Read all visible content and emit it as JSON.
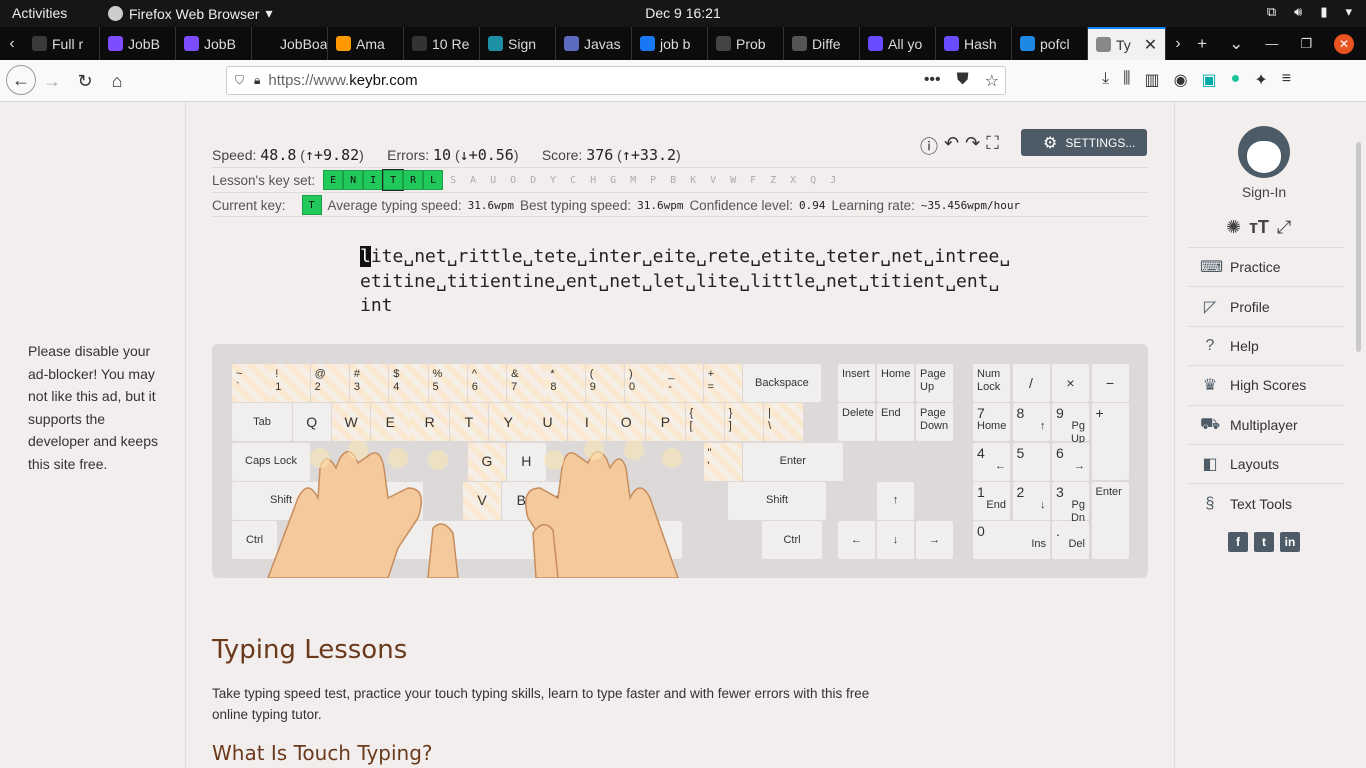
{
  "topbar": {
    "activities": "Activities",
    "app_name": "Firefox Web Browser",
    "app_menu_icon": "chevron-down-icon",
    "clock": "Dec 9  16:21"
  },
  "tabs": [
    {
      "title": "Full r",
      "icon_color": "#3a3a3a"
    },
    {
      "title": "JobB",
      "icon_color": "#7b4dff"
    },
    {
      "title": "JobB",
      "icon_color": "#7b4dff"
    },
    {
      "title": "JobBoar",
      "icon_color": ""
    },
    {
      "title": "Ama",
      "icon_color": "#ff9900"
    },
    {
      "title": "10 Re",
      "icon_color": "#333"
    },
    {
      "title": "Sign",
      "icon_color": "#1e90a6"
    },
    {
      "title": "Javas",
      "icon_color": "#5c6bc0"
    },
    {
      "title": "job b",
      "icon_color": "#1877f2"
    },
    {
      "title": "Prob",
      "icon_color": "#444"
    },
    {
      "title": "Diffe",
      "icon_color": "#555"
    },
    {
      "title": "All yo",
      "icon_color": "#6a4cff"
    },
    {
      "title": "Hash",
      "icon_color": "#6a4cff"
    },
    {
      "title": "pofcl",
      "icon_color": "#1e88e5"
    },
    {
      "title": "Ty",
      "icon_color": "#888",
      "active": true
    }
  ],
  "address": {
    "scheme": "https://www.",
    "host": "keybr.com"
  },
  "stats": {
    "speed_label": "Speed:",
    "speed": "48.8",
    "speed_delta": "↑+9.82",
    "errors_label": "Errors:",
    "errors": "10",
    "errors_delta": "↓+0.56",
    "score_label": "Score:",
    "score": "376",
    "score_delta": "↑+33.2"
  },
  "settings_label": "SETTINGS...",
  "keyset": {
    "label": "Lesson's key set:",
    "keys": [
      "E",
      "N",
      "I",
      "T",
      "R",
      "L",
      "S",
      "A",
      "U",
      "O",
      "D",
      "Y",
      "C",
      "H",
      "G",
      "M",
      "P",
      "B",
      "K",
      "V",
      "W",
      "F",
      "Z",
      "X",
      "Q",
      "J"
    ],
    "enabled_count": 6,
    "current": "T"
  },
  "current": {
    "label": "Current key:",
    "key": "T",
    "avg_label": "Average typing speed:",
    "avg": "31.6wpm",
    "best_label": "Best typing speed:",
    "best": "31.6wpm",
    "conf_label": "Confidence level:",
    "conf": "0.94",
    "rate_label": "Learning rate:",
    "rate": "~35.456wpm/hour"
  },
  "lesson": {
    "first_char": "l",
    "line1_rest": "ite␣net␣rittle␣tete␣inter␣eite␣rete␣etite␣teter␣net␣intree␣",
    "line2": "etitine␣titientine␣ent␣net␣let␣lite␣little␣net␣titient␣ent␣",
    "line3": "int"
  },
  "ad": {
    "text": "Please disable your ad-blocker! You may not like this ad, but it supports the developer and keeps this site free."
  },
  "article": {
    "h1": "Typing Lessons",
    "intro": "Take typing speed test, practice your touch typing skills, learn to type faster and with fewer errors with this free online typing tutor.",
    "h2": "What Is Touch Typing?"
  },
  "sidebar": {
    "signin": "Sign-In",
    "items": [
      {
        "label": "Practice",
        "icon": "keyboard-icon"
      },
      {
        "label": "Profile",
        "icon": "chart-icon"
      },
      {
        "label": "Help",
        "icon": "help-icon"
      },
      {
        "label": "High Scores",
        "icon": "trophy-icon"
      },
      {
        "label": "Multiplayer",
        "icon": "car-icon"
      },
      {
        "label": "Layouts",
        "icon": "layouts-icon"
      },
      {
        "label": "Text Tools",
        "icon": "section-icon"
      }
    ]
  },
  "keyboard": {
    "row1": [
      [
        "~",
        "`"
      ],
      [
        "!",
        "1"
      ],
      [
        "@",
        "2"
      ],
      [
        "#",
        "3"
      ],
      [
        "$",
        "4"
      ],
      [
        "%",
        "5"
      ],
      [
        "^",
        "6"
      ],
      [
        "&",
        "7"
      ],
      [
        "*",
        "8"
      ],
      [
        "(",
        "9"
      ],
      [
        ")",
        "0"
      ],
      [
        "_",
        "-"
      ],
      [
        "+",
        "="
      ]
    ],
    "backspace": "Backspace",
    "tab": "Tab",
    "row2": [
      "Q",
      "W",
      "E",
      "R",
      "T",
      "Y",
      "U",
      "I",
      "O",
      "P"
    ],
    "row2_sym": [
      [
        "{",
        "["
      ],
      [
        "}",
        "]"
      ],
      [
        "|",
        "\\"
      ]
    ],
    "caps": "Caps Lock",
    "row3_visible": [
      "G",
      "H"
    ],
    "semicolon": [
      ";",
      ";"
    ],
    "quote": [
      "\"",
      "'"
    ],
    "enter": "Enter",
    "shift": "Shift",
    "row4_visible": [
      "X",
      "V",
      "B",
      "N"
    ],
    "ctrl": "Ctrl",
    "nav": [
      "Insert",
      "Home",
      "Page Up",
      "Delete",
      "End",
      "Page Down"
    ],
    "arrows": [
      "↑",
      "←",
      "↓",
      "→"
    ],
    "numpad": {
      "numlock": "Num Lock",
      "div": "/",
      "mul": "×",
      "minus": "−",
      "plus": "+",
      "enter": "Enter",
      "n7": [
        "7",
        "Home"
      ],
      "n8": [
        "8",
        "↑"
      ],
      "n9": [
        "9",
        "Pg Up"
      ],
      "n4": [
        "4",
        "←"
      ],
      "n5": [
        "5",
        ""
      ],
      "n6": [
        "6",
        "→"
      ],
      "n1": [
        "1",
        "End"
      ],
      "n2": [
        "2",
        "↓"
      ],
      "n3": [
        "3",
        "Pg Dn"
      ],
      "n0": [
        "0",
        "Ins"
      ],
      "dot": [
        ".",
        "Del"
      ]
    }
  }
}
